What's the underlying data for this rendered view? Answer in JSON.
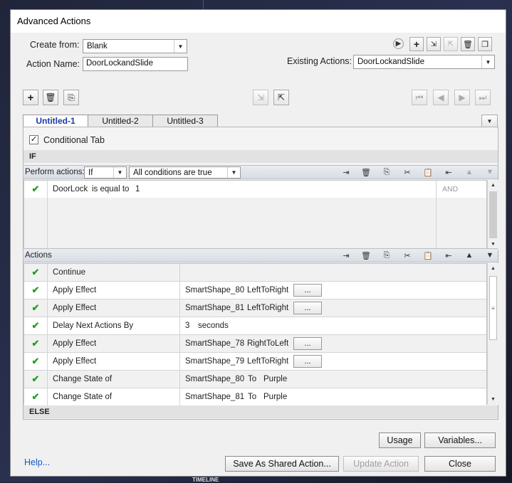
{
  "window": {
    "title": "Advanced Actions"
  },
  "create_from": {
    "label": "Create from:",
    "value": "Blank"
  },
  "action_name": {
    "label": "Action Name:",
    "value": "DoorLockandSlide"
  },
  "existing_actions": {
    "label": "Existing Actions:",
    "value": "DoorLockandSlide"
  },
  "tabs": [
    {
      "label": "Untitled-1",
      "active": true
    },
    {
      "label": "Untitled-2",
      "active": false
    },
    {
      "label": "Untitled-3",
      "active": false
    }
  ],
  "conditional_tab": {
    "label": "Conditional Tab",
    "checked": true
  },
  "if_section": {
    "header": "IF",
    "perform_label": "Perform actions:",
    "perform_value": "If",
    "conditions_value": "All conditions are true",
    "rows": [
      {
        "variable": "DoorLock",
        "operator": "is equal to",
        "value": "1",
        "connector": "AND"
      }
    ]
  },
  "actions_section": {
    "header": "Actions",
    "rows": [
      {
        "action": "Continue",
        "target": "",
        "param": "",
        "extra": "",
        "has_dots": false
      },
      {
        "action": "Apply Effect",
        "target": "SmartShape_80",
        "param": "LeftToRight",
        "extra": "",
        "has_dots": true
      },
      {
        "action": "Apply Effect",
        "target": "SmartShape_81",
        "param": "LeftToRight",
        "extra": "",
        "has_dots": true
      },
      {
        "action": "Delay Next Actions By",
        "target": "3",
        "param": "seconds",
        "extra": "",
        "has_dots": false
      },
      {
        "action": "Apply Effect",
        "target": "SmartShape_78",
        "param": "RightToLeft",
        "extra": "",
        "has_dots": true
      },
      {
        "action": "Apply Effect",
        "target": "SmartShape_79",
        "param": "LeftToRight",
        "extra": "",
        "has_dots": true
      },
      {
        "action": "Change State of",
        "target": "SmartShape_80",
        "param": "To",
        "extra": "Purple",
        "has_dots": false
      },
      {
        "action": "Change State of",
        "target": "SmartShape_81",
        "param": "To",
        "extra": "Purple",
        "has_dots": false
      }
    ],
    "dots_label": "..."
  },
  "else_section": {
    "header": "ELSE"
  },
  "buttons": {
    "usage": "Usage",
    "variables": "Variables...",
    "help": "Help...",
    "save_shared": "Save As Shared Action...",
    "update": "Update Action",
    "close": "Close"
  },
  "background_footer": "TIMELINE",
  "colors": {
    "check": "#21a021",
    "active_tab": "#1a3aa8",
    "link": "#1a58c4"
  }
}
